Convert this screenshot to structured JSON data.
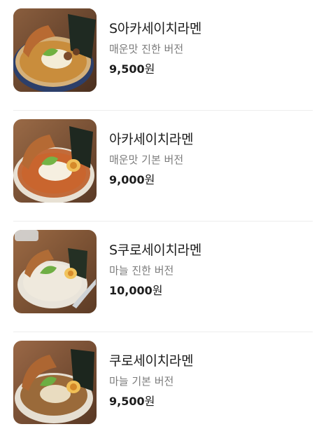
{
  "menu": {
    "items": [
      {
        "name": "S아카세이치라멘",
        "description": "매운맛 진한 버전",
        "price": "9,500",
        "currency": "원",
        "image": "ramen-thumbnail-miso",
        "broth_color": "#c98d3c"
      },
      {
        "name": "아카세이치라멘",
        "description": "매운맛 기본 버전",
        "price": "9,000",
        "currency": "원",
        "image": "ramen-thumbnail-spicy",
        "broth_color": "#c9652e"
      },
      {
        "name": "S쿠로세이치라멘",
        "description": "마늘 진한 버전",
        "price": "10,000",
        "currency": "원",
        "image": "ramen-thumbnail-white",
        "broth_color": "#efe9dd"
      },
      {
        "name": "쿠로세이치라멘",
        "description": "마늘 기본 버전",
        "price": "9,500",
        "currency": "원",
        "image": "ramen-thumbnail-soy",
        "broth_color": "#9a6a3a"
      }
    ]
  }
}
